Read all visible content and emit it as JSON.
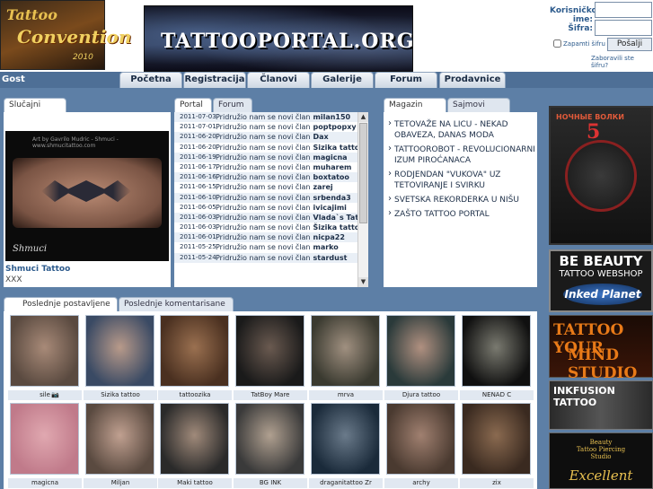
{
  "header": {
    "left_logo": {
      "line1": "Tattoo",
      "line2": "Convention",
      "line3": "2010"
    },
    "banner_text": "TATTOOPORTAL.ORG",
    "login": {
      "username_label": "Korisničko ime:",
      "password_label": "Šifra:",
      "remember_label": "Zapamti šifru",
      "submit_label": "Pošalji",
      "forgot_label": "Zaboravili ste šifru?"
    }
  },
  "nav": {
    "user_status": "Gost",
    "items": [
      "Početna",
      "Registracija",
      "Članovi",
      "Galerije",
      "Forum",
      "Prodavnice"
    ]
  },
  "random_tattoo": {
    "tab": "Slučajni tattoo",
    "image_caption": "Art by Gavrilo Mudric - Shmuci - www.shmucitattoo.com",
    "image_signature": "Shmuci",
    "name": "Shmuci Tattoo",
    "author": "XXX"
  },
  "portal": {
    "tabs": [
      "Portal",
      "Forum"
    ],
    "rows": [
      {
        "date": "2011-07-03",
        "text": "Pridružio nam se novi član",
        "user": "milan150"
      },
      {
        "date": "2011-07-01",
        "text": "Pridružio nam se novi član",
        "user": "poptpopxy"
      },
      {
        "date": "2011-06-20",
        "text": "Pridružio nam se novi član",
        "user": "Dax"
      },
      {
        "date": "2011-06-20",
        "text": "Pridružio nam se novi član",
        "user": "Sizika tattoo"
      },
      {
        "date": "2011-06-19",
        "text": "Pridružio nam se novi član",
        "user": "magicna"
      },
      {
        "date": "2011-06-17",
        "text": "Pridružio nam se novi član",
        "user": "muharem"
      },
      {
        "date": "2011-06-16",
        "text": "Pridružio nam se novi član",
        "user": "boxtatoo"
      },
      {
        "date": "2011-06-15",
        "text": "Pridružio nam se novi član",
        "user": "zarej"
      },
      {
        "date": "2011-06-10",
        "text": "Pridružio nam se novi član",
        "user": "srbenda3"
      },
      {
        "date": "2011-06-05",
        "text": "Pridružio nam se novi član",
        "user": "ivicajimi"
      },
      {
        "date": "2011-06-03",
        "text": "Pridružio nam se novi član",
        "user": "Vlada`s Tattoo"
      },
      {
        "date": "2011-06-03",
        "text": "Pridružio nam se novi član",
        "user": "Šizika tattoo"
      },
      {
        "date": "2011-06-01",
        "text": "Pridružio nam se novi član",
        "user": "nicpa22"
      },
      {
        "date": "2011-05-25",
        "text": "Pridružio nam se novi član",
        "user": "marko"
      },
      {
        "date": "2011-05-24",
        "text": "Pridružio nam se novi član",
        "user": "stardust"
      }
    ]
  },
  "magazin": {
    "tabs": [
      "Magazin",
      "Sajmovi"
    ],
    "items": [
      "TETOVAŽE NA LICU - NEKAD OBAVEZA, DANAS MODA",
      "TATTOOROBOT - REVOLUCIONARNI IZUM PIROĆANACA",
      "RODJENDAN \"VUKOVA\" UZ TETOVIRANJE I SVIRKU",
      "SVETSKA REKORDERKA U NIŠU",
      "ZAŠTO TATTOO PORTAL"
    ]
  },
  "ads": {
    "ad1": {
      "top": "НОЧНЫЕ ВОЛКИ",
      "number": "5"
    },
    "ad2": {
      "line1": "BE BEAUTY",
      "line2": "TATTOO WEBSHOP",
      "line3": "Inked Planet"
    },
    "ad3": {
      "line1": "TATTOO YOUR",
      "line2": "MIND STUDIO"
    },
    "ad4": {
      "line1": "INKFUSION TATTOO"
    },
    "ad5": {
      "line1": "Beauty",
      "line2": "Tattoo Piercing",
      "line3": "Studio",
      "line4": "Excellent"
    }
  },
  "gallery": {
    "tabs": [
      "Poslednje postavljene",
      "Poslednje komentarisane"
    ],
    "row1": [
      {
        "caption": "sile",
        "badge": "📷",
        "c1": "#5a4a40",
        "c2": "#a88a78"
      },
      {
        "caption": "Sizika tattoo",
        "c1": "#3a4a64",
        "c2": "#b89a8a"
      },
      {
        "caption": "tattoozika",
        "c1": "#4a3020",
        "c2": "#9a7050"
      },
      {
        "caption": "TatBoy Mare",
        "c1": "#1a1a1a",
        "c2": "#6a5a50"
      },
      {
        "caption": "mrva",
        "c1": "#3a3a30",
        "c2": "#a09080"
      },
      {
        "caption": "Djura tattoo",
        "c1": "#2a3a3a",
        "c2": "#b09080"
      },
      {
        "caption": "NENAD C",
        "c1": "#101010",
        "c2": "#7a7a70"
      }
    ],
    "row2": [
      {
        "caption": "magicna",
        "c1": "#c07a8a",
        "c2": "#e0a8b0"
      },
      {
        "caption": "Miljan",
        "c1": "#5a4a40",
        "c2": "#c0a090"
      },
      {
        "caption": "Maki tattoo",
        "c1": "#2a2a2a",
        "c2": "#a08a7a"
      },
      {
        "caption": "BG INK",
        "c1": "#3a3a3a",
        "c2": "#b0a090"
      },
      {
        "caption": "draganitattoo Zr",
        "c1": "#1a2a3a",
        "c2": "#6a7a8a"
      },
      {
        "caption": "archy",
        "c1": "#4a3a30",
        "c2": "#a08070"
      },
      {
        "caption": "zix",
        "c1": "#3a2a20",
        "c2": "#8a6a50"
      }
    ]
  }
}
